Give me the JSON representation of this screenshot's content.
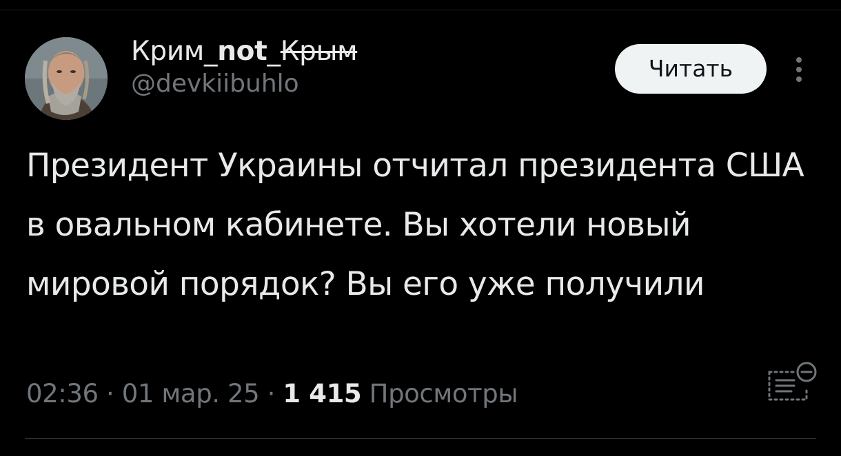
{
  "post": {
    "author": {
      "name_regular": "Крим_",
      "name_bold": "not",
      "name_sep": "_",
      "name_struck": "Крым",
      "handle": "@devkiibuhlo"
    },
    "follow_label": "Читать",
    "text": "Президент Украины отчитал президента США в овальном кабинете. Вы хотели новый мировой порядок? Вы его уже получили",
    "time": "02:36",
    "date": "01 мар. 25",
    "separator": "·",
    "views_count": "1 415",
    "views_label": "Просмотры"
  },
  "icons": {
    "more": "more-vertical-icon",
    "stats": "post-analytics-icon"
  },
  "colors": {
    "background": "#000000",
    "text_primary": "#e7e9ea",
    "text_secondary": "#71767b",
    "button_bg": "#eff3f4",
    "divider": "#2f3336"
  }
}
